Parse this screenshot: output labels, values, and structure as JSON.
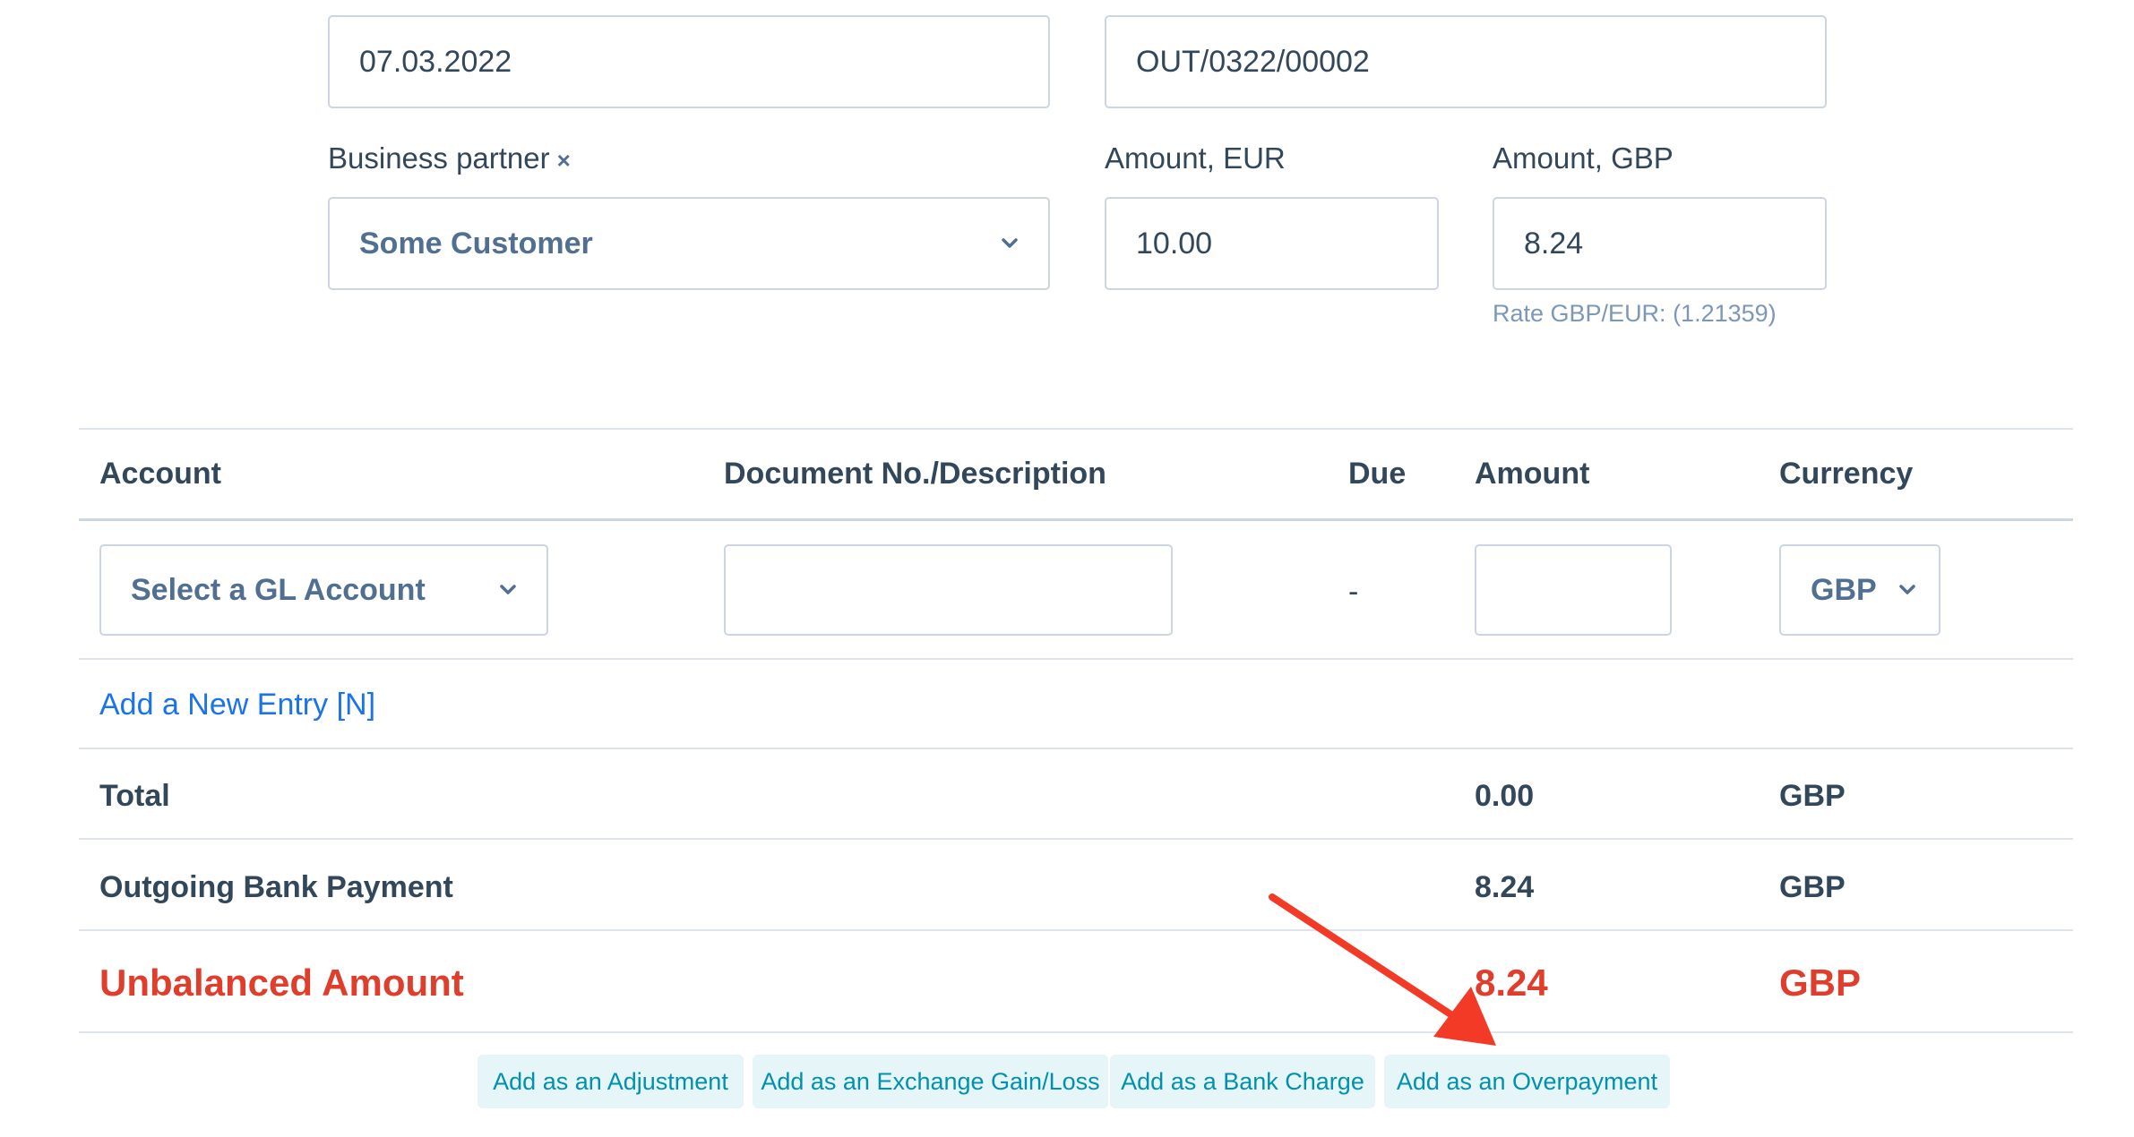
{
  "header_fields": {
    "date_value": "07.03.2022",
    "doc_number_value": "OUT/0322/00002"
  },
  "partner": {
    "label": "Business partner",
    "clear_icon": "×",
    "value": "Some Customer"
  },
  "amount_eur": {
    "label": "Amount, EUR",
    "value": "10.00"
  },
  "amount_gbp": {
    "label": "Amount, GBP",
    "value": "8.24",
    "rate_hint": "Rate GBP/EUR: (1.21359)"
  },
  "table": {
    "columns": [
      "Account",
      "Document No./Description",
      "Due",
      "Amount",
      "Currency"
    ],
    "entry_row": {
      "account_placeholder": "Select a GL Account",
      "description_value": "",
      "due": "-",
      "amount_value": "",
      "currency": "GBP"
    },
    "add_entry_label": "Add a New Entry [N]",
    "total": {
      "label": "Total",
      "amount": "0.00",
      "currency": "GBP"
    },
    "payment": {
      "label": "Outgoing Bank Payment",
      "amount": "8.24",
      "currency": "GBP"
    },
    "unbalanced": {
      "label": "Unbalanced Amount",
      "amount": "8.24",
      "currency": "GBP"
    }
  },
  "actions": {
    "adjustment": "Add as an Adjustment",
    "exchange": "Add as an Exchange Gain/Loss",
    "bank_charge": "Add as a Bank Charge",
    "overpayment": "Add as an Overpayment"
  },
  "colors": {
    "text": "#33475b",
    "border": "#cbd6e2",
    "link": "#1a73e8",
    "alert": "#e03e2d",
    "button_bg": "#e5f5f8",
    "button_text": "#0091ae",
    "arrow": "#f23a26"
  }
}
